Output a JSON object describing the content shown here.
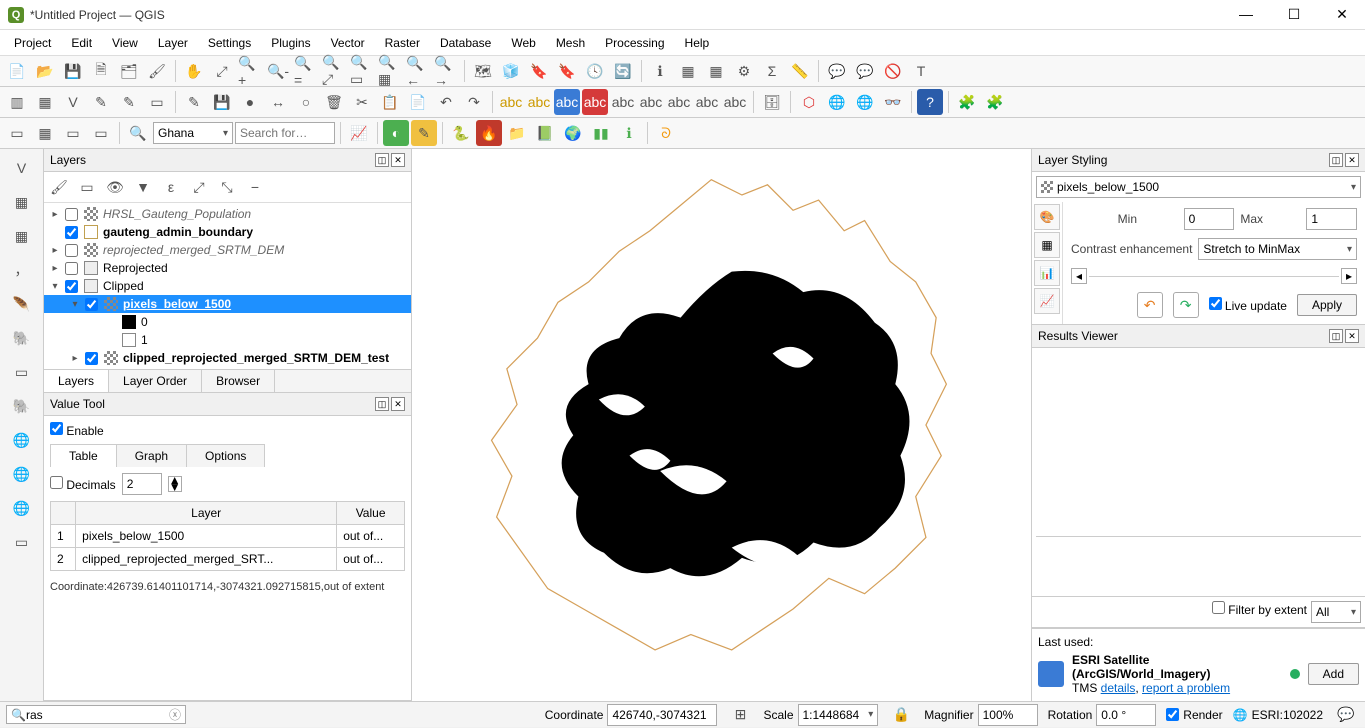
{
  "window": {
    "title": "*Untitled Project — QGIS"
  },
  "menu": [
    "Project",
    "Edit",
    "View",
    "Layer",
    "Settings",
    "Plugins",
    "Vector",
    "Raster",
    "Database",
    "Web",
    "Mesh",
    "Processing",
    "Help"
  ],
  "locator": {
    "combo": "Ghana",
    "placeholder": "Search for…"
  },
  "layersPanel": {
    "title": "Layers",
    "tabs": [
      "Layers",
      "Layer Order",
      "Browser"
    ],
    "tree": [
      {
        "indent": 0,
        "tw": "▸",
        "chk": false,
        "icon": "checker",
        "name": "HRSL_Gauteng_Population",
        "style": "italic"
      },
      {
        "indent": 0,
        "tw": "",
        "chk": true,
        "icon": "box",
        "name": "gauteng_admin_boundary",
        "style": "bold"
      },
      {
        "indent": 0,
        "tw": "▸",
        "chk": false,
        "icon": "checker",
        "name": "reprojected_merged_SRTM_DEM",
        "style": "italic"
      },
      {
        "indent": 0,
        "tw": "▸",
        "chk": false,
        "icon": "group",
        "name": "Reprojected",
        "style": ""
      },
      {
        "indent": 0,
        "tw": "▾",
        "chk": true,
        "icon": "group",
        "name": "Clipped",
        "style": ""
      },
      {
        "indent": 1,
        "tw": "▾",
        "chk": true,
        "icon": "checker",
        "name": "pixels_below_1500",
        "style": "bold",
        "sel": true,
        "underline": true
      },
      {
        "indent": 2,
        "tw": "",
        "icon": "black",
        "name": "0",
        "style": ""
      },
      {
        "indent": 2,
        "tw": "",
        "icon": "white",
        "name": "1",
        "style": ""
      },
      {
        "indent": 1,
        "tw": "▸",
        "chk": true,
        "icon": "checker",
        "name": "clipped_reprojected_merged_SRTM_DEM_test",
        "style": "bold"
      }
    ]
  },
  "valueTool": {
    "title": "Value Tool",
    "enable": "Enable",
    "tabs": [
      "Table",
      "Graph",
      "Options"
    ],
    "decimals_label": "Decimals",
    "decimals": "2",
    "headers": [
      "",
      "Layer",
      "Value"
    ],
    "rows": [
      {
        "n": "1",
        "layer": "pixels_below_1500",
        "value": "out of..."
      },
      {
        "n": "2",
        "layer": "clipped_reprojected_merged_SRT...",
        "value": "out of..."
      }
    ],
    "coord": "Coordinate:426739.61401101714,-3074321.092715815,out of extent"
  },
  "layerStyling": {
    "title": "Layer Styling",
    "layer": "pixels_below_1500",
    "min_label": "Min",
    "min": "0",
    "max_label": "Max",
    "max": "1",
    "contrast_label": "Contrast enhancement",
    "contrast": "Stretch to MinMax",
    "live_update": "Live update",
    "apply": "Apply"
  },
  "resultsViewer": {
    "title": "Results Viewer",
    "filter_label": "Filter by extent",
    "all": "All"
  },
  "lastUsed": {
    "label": "Last used:",
    "title": "ESRI Satellite (ArcGIS/World_Imagery)",
    "sub_prefix": "TMS ",
    "details": "details",
    "report": "report a problem",
    "add": "Add"
  },
  "status": {
    "search": "ras",
    "coord_label": "Coordinate",
    "coord": "426740,-3074321",
    "scale_label": "Scale",
    "scale": "1:1448684",
    "mag_label": "Magnifier",
    "mag": "100%",
    "rot_label": "Rotation",
    "rot": "0.0 °",
    "render": "Render",
    "crs": "ESRI:102022"
  }
}
